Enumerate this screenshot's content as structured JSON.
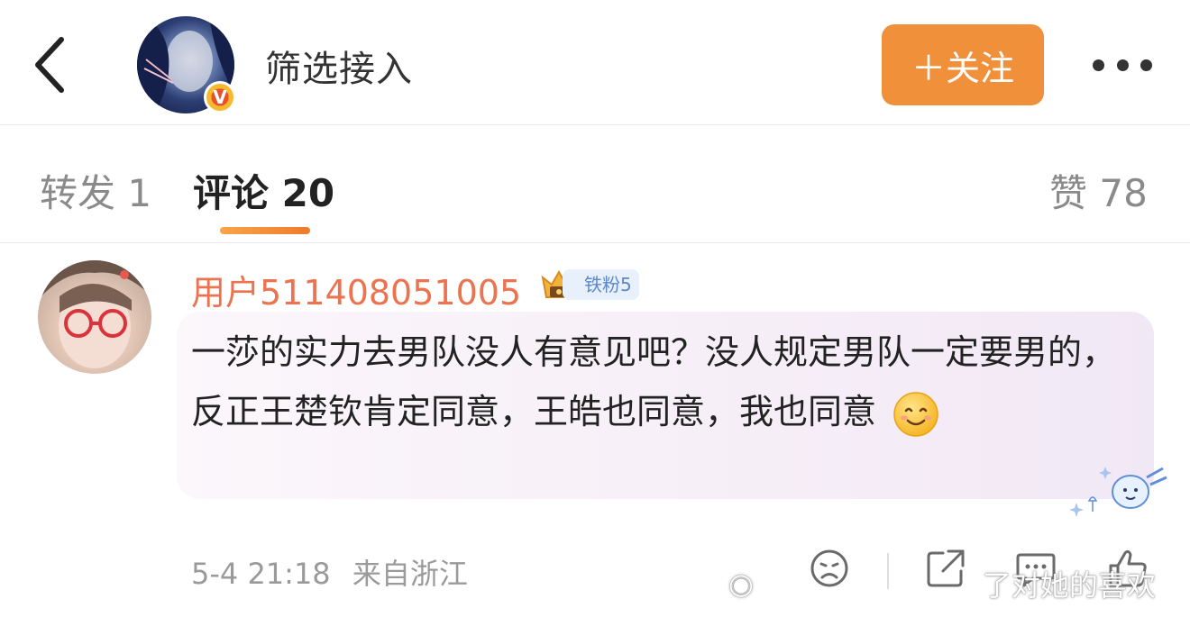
{
  "header": {
    "back_icon": "chevron-left-icon",
    "account_name": "筛选接入",
    "verified_badge": "V",
    "follow_label": "＋关注",
    "more_icon": "more-horizontal-icon"
  },
  "tabs": {
    "repost": "转发 1",
    "comment": "评论 20",
    "like": "赞 78"
  },
  "comment": {
    "username": "用户5114080510​05",
    "fan_badge": "铁粉5",
    "text": "一莎的实力去男队没人有意见吧？没人规定男队一定要男的，反正王楚钦肯定同意，王皓也同意，我也同意",
    "emoji_icon": "smile-icon",
    "time": "5-4 21:18",
    "location": "来自浙江",
    "actions": [
      "dislike-icon",
      "share-icon",
      "comment-icon",
      "like-icon"
    ]
  },
  "watermark": {
    "text": "了对她的喜欢"
  },
  "colors": {
    "accent": "#f1903a",
    "username": "#eb7350",
    "bubble": "#f6eef7"
  }
}
